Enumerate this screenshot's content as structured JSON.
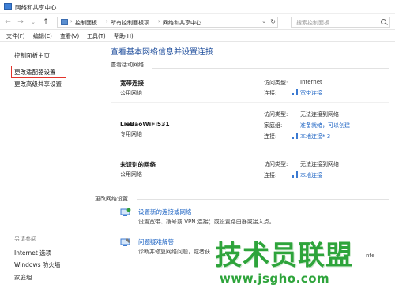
{
  "window": {
    "title": "网络和共享中心"
  },
  "address": {
    "crumbs": [
      "控制面板",
      "所有控制面板项",
      "网络和共享中心"
    ],
    "search_placeholder": "搜索控制面板"
  },
  "menu": [
    "文件(F)",
    "编辑(E)",
    "查看(V)",
    "工具(T)",
    "帮助(H)"
  ],
  "sidebar": {
    "items": [
      "控制面板主页",
      "更改适配器设置",
      "更改高级共享设置"
    ],
    "see_also_label": "另请参阅",
    "see_also": [
      "Internet 选项",
      "Windows 防火墙",
      "家庭组"
    ]
  },
  "main": {
    "title": "查看基本网络信息并设置连接",
    "active_heading": "查看活动网络",
    "networks": [
      {
        "name": "宽带连接",
        "type": "公用网络",
        "rows": [
          {
            "label": "访问类型:",
            "value": "Internet"
          },
          {
            "label": "连接:",
            "value": "宽带连接"
          }
        ]
      },
      {
        "name": "LieBaoWiFi531",
        "type": "专用网络",
        "rows": [
          {
            "label": "访问类型:",
            "value": "无法连接到网络"
          },
          {
            "label": "家庭组:",
            "value": "准备就绪，可以创建"
          },
          {
            "label": "连接:",
            "value": "本地连接* 3"
          }
        ]
      },
      {
        "name": "未识别的网络",
        "type": "公用网络",
        "rows": [
          {
            "label": "访问类型:",
            "value": "无法连接到网络"
          },
          {
            "label": "连接:",
            "value": "本地连接"
          }
        ]
      }
    ],
    "change_heading": "更改网络设置",
    "settings": [
      {
        "title": "设置新的连接或网络",
        "desc": "设置宽带、拨号或 VPN 连接；或设置路由器或接入点。"
      },
      {
        "title": "问题疑难解答",
        "desc": "诊断并修复网络问题，或者获"
      }
    ]
  },
  "watermark": {
    "logo": "技术员联盟",
    "url": "www.jsgho.com",
    "tail": "nte"
  },
  "colors": {
    "link": "#1f65c4",
    "title_blue": "#1f4e9c",
    "highlight": "#e2332b",
    "watermark": "#2ea43b"
  }
}
